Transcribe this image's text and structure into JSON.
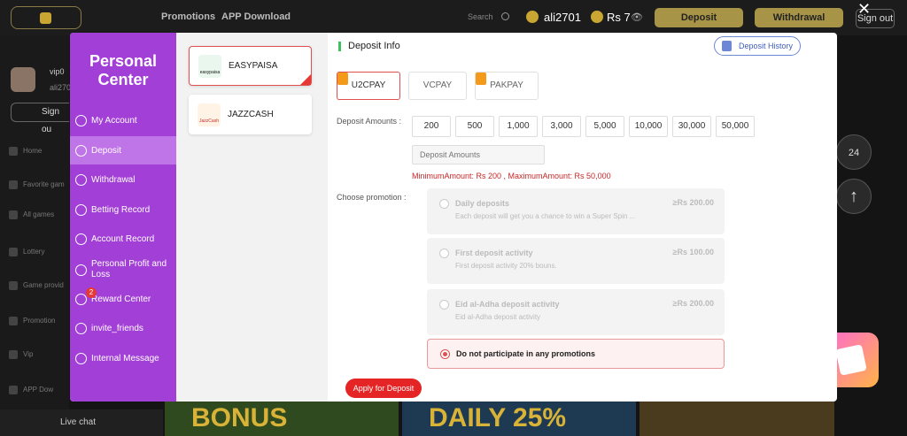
{
  "header": {
    "nav": [
      "Promotions",
      "APP Download"
    ],
    "search_label": "Search",
    "username": "ali2701",
    "balance": "Rs 7",
    "deposit_label": "Deposit",
    "withdrawal_label": "Withdrawal",
    "signout_label": "Sign out"
  },
  "background_sidebar": {
    "vip": "vip0",
    "user_short": "ali270",
    "signout": "Sign ou",
    "items": [
      "Home",
      "Favorite gam",
      "All games",
      "Lottery",
      "Game provid",
      "Promotion",
      "Vip",
      "APP Dow"
    ],
    "live_chat": "Live chat"
  },
  "banners": [
    "BONUS",
    "DAILY 25%"
  ],
  "modal": {
    "title": "Personal Center",
    "menu": [
      {
        "label": "My Account"
      },
      {
        "label": "Deposit",
        "active": true
      },
      {
        "label": "Withdrawal"
      },
      {
        "label": "Betting Record"
      },
      {
        "label": "Account Record"
      },
      {
        "label": "Personal Profit and Loss"
      },
      {
        "label": "Reward Center",
        "badge": "2"
      },
      {
        "label": "invite_friends"
      },
      {
        "label": "Internal Message"
      }
    ],
    "methods": [
      {
        "name": "EASYPAISA",
        "logo_text": "easypaisa",
        "selected": true
      },
      {
        "name": "JAZZCASH",
        "logo_text": "JazzCash"
      }
    ],
    "deposit_info_label": "Deposit Info",
    "deposit_history_label": "Deposit History",
    "channels": [
      {
        "label": "U2CPAY",
        "active": true
      },
      {
        "label": "VCPAY"
      },
      {
        "label": "PAKPAY"
      }
    ],
    "deposit_amounts_label": "Deposit Amounts :",
    "amounts": [
      "200",
      "500",
      "1,000",
      "3,000",
      "5,000",
      "10,000",
      "30,000",
      "50,000"
    ],
    "amount_placeholder": "Deposit Amounts",
    "min_max": "MinimumAmount:  Rs  200  ,  MaximumAmount:  Rs  50,000",
    "choose_promotion_label": "Choose promotion :",
    "promotions": [
      {
        "title": "Daily deposits",
        "desc": "Each deposit will get you a chance to win a Super Spin ...",
        "amount": "≥Rs  200.00"
      },
      {
        "title": "First deposit activity",
        "desc": "First deposit activity 20% bouns.",
        "amount": "≥Rs  100.00"
      },
      {
        "title": "Eid al-Adha deposit activity",
        "desc": "Eid al-Adha deposit activity",
        "amount": "≥Rs  200.00"
      },
      {
        "title": "Do not participate in any promotions",
        "selected": true
      }
    ],
    "apply_label": "Apply for Deposit"
  },
  "colors": {
    "sidebar_purple": "#a23fd6",
    "active_item": "#bf74e7",
    "accent_red": "#e52525",
    "gold": "#a89446"
  }
}
